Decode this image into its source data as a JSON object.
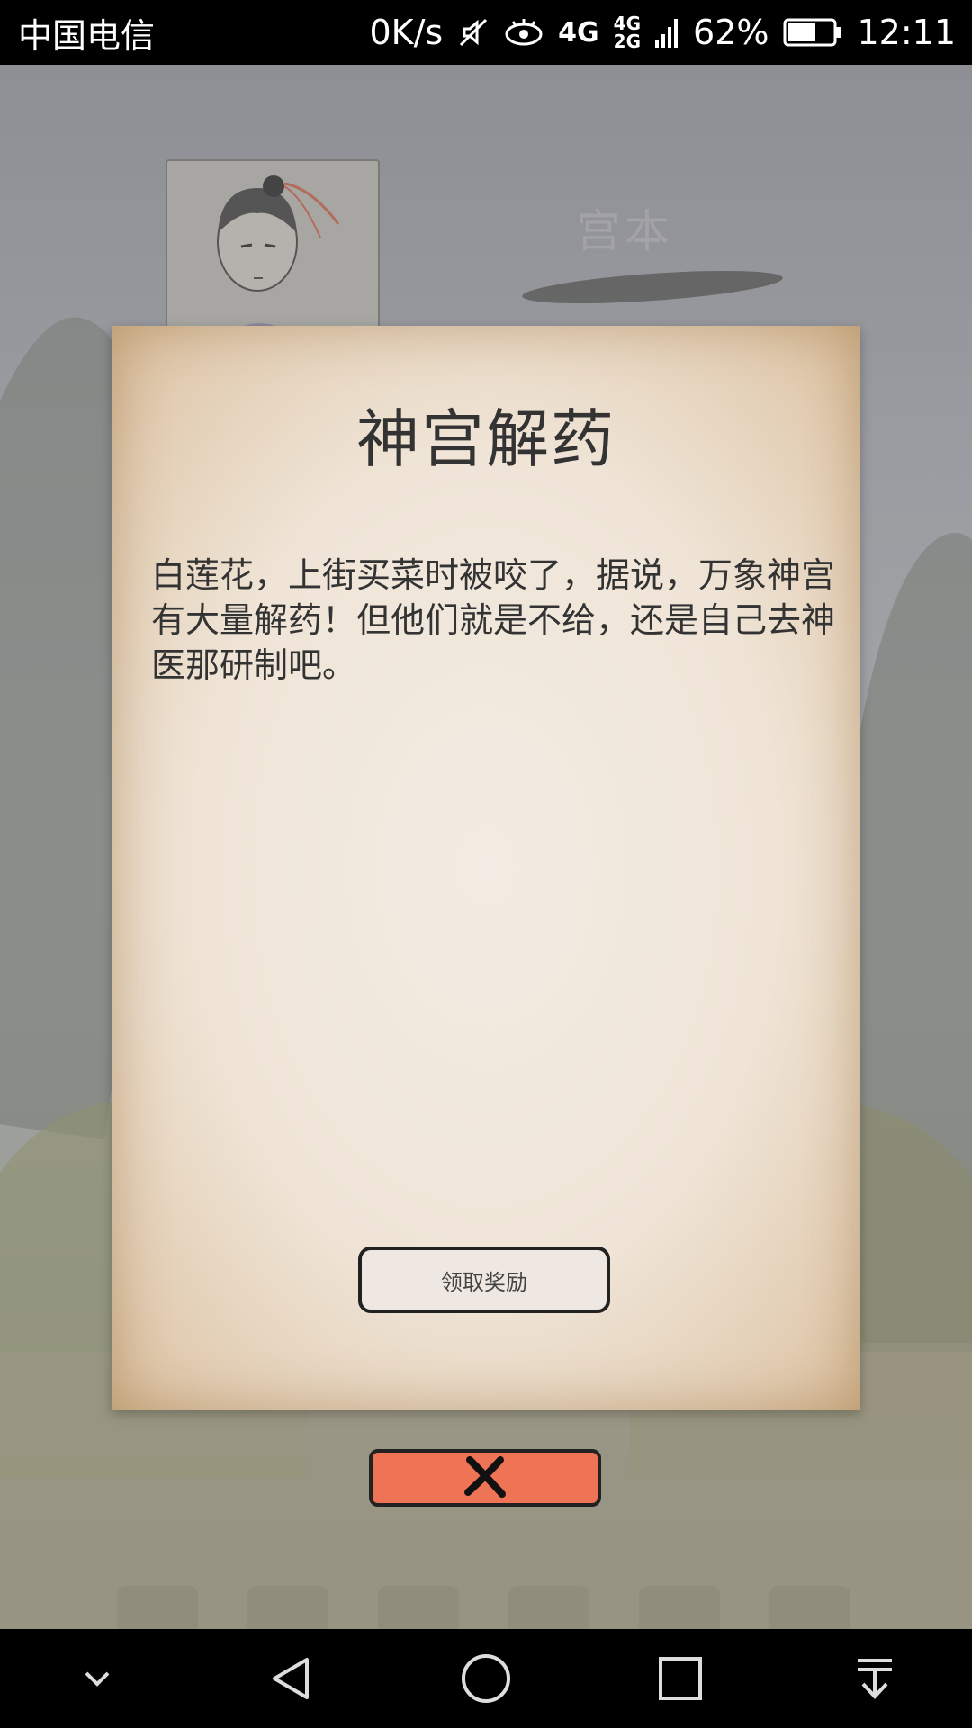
{
  "status_bar": {
    "carrier": "中国电信",
    "net_speed": "0K/s",
    "network_type": "4G",
    "network_type_secondary": "4G",
    "network_type_tertiary": "2G",
    "battery_percent": "62%",
    "battery_level": 0.62,
    "time": "12:11",
    "icons": [
      "mute-icon",
      "eye-comfort-icon",
      "signal-icon",
      "battery-icon"
    ]
  },
  "background": {
    "character_name": "宫本"
  },
  "dialog": {
    "title": "神宫解药",
    "body": "白莲花，上街买菜时被咬了，据说，万象神宫有大量解药！但他们就是不给，还是自己去神医那研制吧。",
    "claim_button_label": "领取奖励",
    "close_icon": "close-icon",
    "colors": {
      "paper": "#efe4d6",
      "close_button": "#ef7355"
    }
  },
  "nav_bar": {
    "icons": [
      "chevron-down-icon",
      "back-icon",
      "home-icon",
      "recents-icon",
      "notification-pull-icon"
    ]
  }
}
